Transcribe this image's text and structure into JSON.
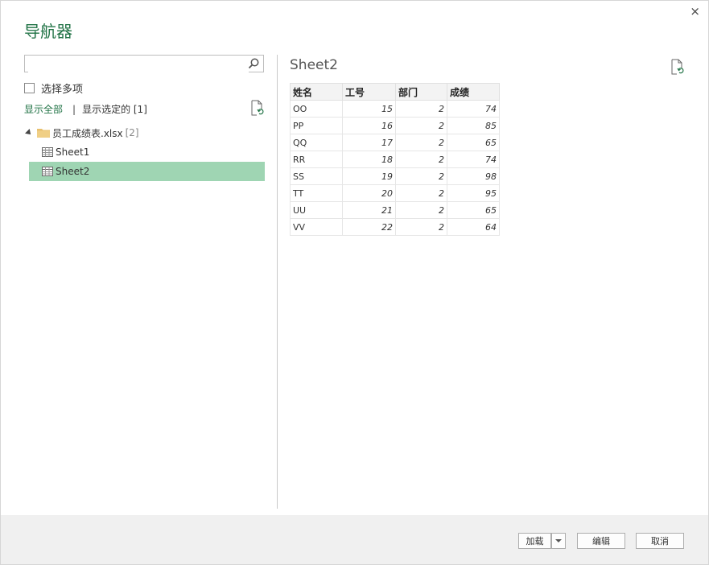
{
  "window": {
    "title": "导航器",
    "close_glyph": "×"
  },
  "left_panel": {
    "search": {
      "value": "",
      "placeholder": ""
    },
    "multi_select_label": "选择多项",
    "show_all_label": "显示全部",
    "separator": "|",
    "show_selected_label": "显示选定的 [1]",
    "tree": {
      "file_name": "员工成绩表.xlsx",
      "file_count": "[2]",
      "items": [
        {
          "label": "Sheet1",
          "selected": false
        },
        {
          "label": "Sheet2",
          "selected": true
        }
      ]
    }
  },
  "preview": {
    "title": "Sheet2",
    "columns": [
      "姓名",
      "工号",
      "部门",
      "成绩"
    ],
    "rows": [
      [
        "OO",
        "15",
        "2",
        "74"
      ],
      [
        "PP",
        "16",
        "2",
        "85"
      ],
      [
        "QQ",
        "17",
        "2",
        "65"
      ],
      [
        "RR",
        "18",
        "2",
        "74"
      ],
      [
        "SS",
        "19",
        "2",
        "98"
      ],
      [
        "TT",
        "20",
        "2",
        "95"
      ],
      [
        "UU",
        "21",
        "2",
        "65"
      ],
      [
        "VV",
        "22",
        "2",
        "64"
      ]
    ]
  },
  "footer": {
    "load_label": "加载",
    "edit_label": "编辑",
    "cancel_label": "取消"
  },
  "colors": {
    "accent": "#217346",
    "selection": "#9fd5b3",
    "footer_bg": "#f0f0f0"
  },
  "icons": {
    "close": "close-icon",
    "search": "search-icon",
    "refresh_file": "refresh-file-icon",
    "folder": "folder-icon",
    "sheet": "sheet-table-icon",
    "expand": "expand-arrow-icon",
    "dropdown": "chevron-down-icon"
  }
}
